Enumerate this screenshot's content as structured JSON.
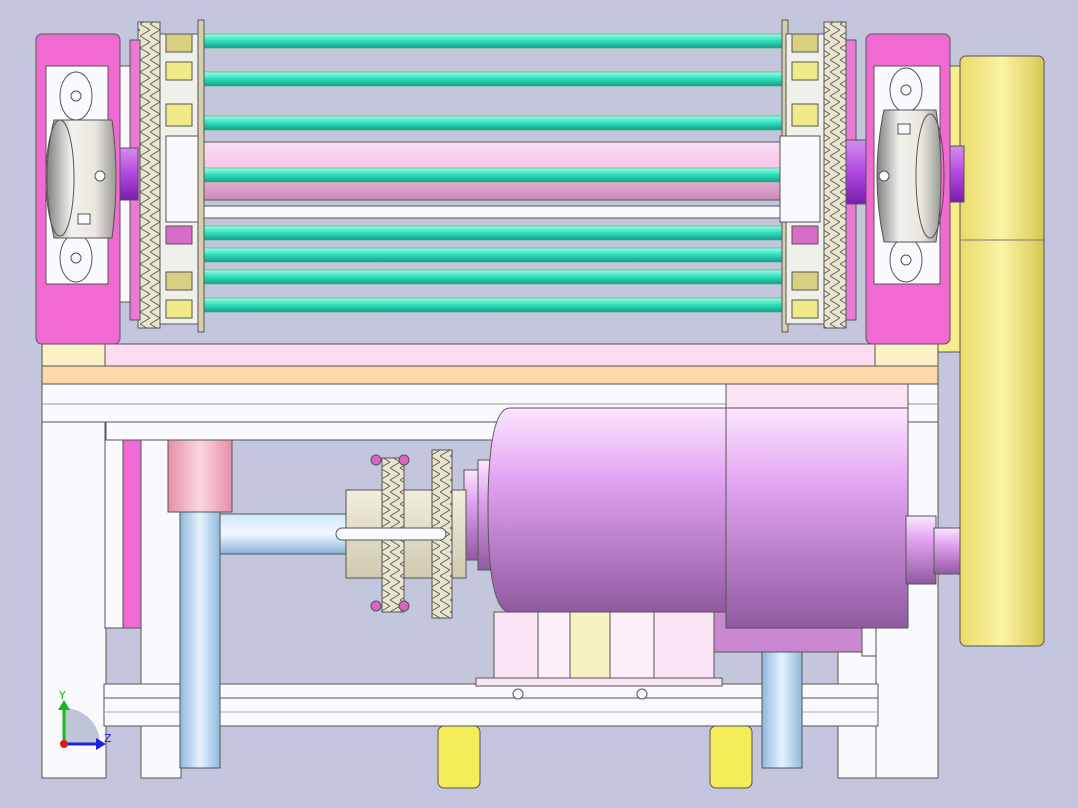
{
  "viewport": {
    "background": "#c3c6dd"
  },
  "triad": {
    "y_label": "Y",
    "z_label": "Z",
    "y_color": "#18b818",
    "z_color": "#2020e0",
    "x_color": "#e01818"
  },
  "colors": {
    "bearing_block": "#f06ad2",
    "rod_green": "#30e3c2",
    "roller_pink": "#f7c3e8",
    "motor_violet": "#e2a3f1",
    "frame_white": "#fafafe",
    "shaft_blue": "#aacfee",
    "pulley_yellow": "#f7ec8e",
    "coupler_salmon": "#f2b2c4",
    "sprocket_beige": "#e9e4cd"
  }
}
